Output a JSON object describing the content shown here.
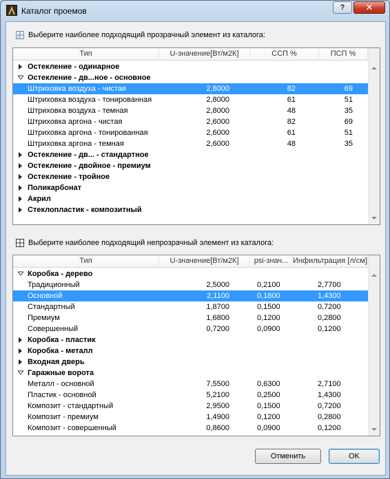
{
  "window": {
    "title": "Каталог проемов",
    "help_label": "?",
    "close_label": "✕"
  },
  "transparent": {
    "label": "Выберите наиболее подходящий прозрачный элемент из каталога:",
    "columns": [
      "Тип",
      "U-значение[Вт/м2К]",
      "ССП %",
      "ПСП %"
    ],
    "rows": [
      {
        "kind": "group",
        "expanded": false,
        "name": "Остекление - одинарное"
      },
      {
        "kind": "group",
        "expanded": true,
        "name": "Остекление - дв...ное - основное"
      },
      {
        "kind": "item",
        "selected": true,
        "name": "Штриховка воздуха - чистая",
        "v1": "2,8000",
        "v2": "82",
        "v3": "69"
      },
      {
        "kind": "item",
        "name": "Штриховка воздуха - тонированная",
        "v1": "2,8000",
        "v2": "61",
        "v3": "51"
      },
      {
        "kind": "item",
        "name": "Штриховка воздуха - темная",
        "v1": "2,8000",
        "v2": "48",
        "v3": "35"
      },
      {
        "kind": "item",
        "name": "Штриховка аргона - чистая",
        "v1": "2,6000",
        "v2": "82",
        "v3": "69"
      },
      {
        "kind": "item",
        "name": "Штриховка аргона - тонированная",
        "v1": "2,6000",
        "v2": "61",
        "v3": "51"
      },
      {
        "kind": "item",
        "name": "Штриховка аргона - темная",
        "v1": "2,6000",
        "v2": "48",
        "v3": "35"
      },
      {
        "kind": "group",
        "expanded": false,
        "name": "Остекление - дв... - стандартное"
      },
      {
        "kind": "group",
        "expanded": false,
        "name": "Остекление - двойное - премиум"
      },
      {
        "kind": "group",
        "expanded": false,
        "name": "Остекление - тройное"
      },
      {
        "kind": "group",
        "expanded": false,
        "name": "Поликарбонат"
      },
      {
        "kind": "group",
        "expanded": false,
        "name": "Акрил"
      },
      {
        "kind": "group",
        "expanded": false,
        "name": "Стеклопластик - композитный"
      }
    ]
  },
  "opaque": {
    "label": "Выберите наиболее подходящий непрозрачный элемент из каталога:",
    "columns": [
      "Тип",
      "U-значение[Вт/м2К]",
      "psi-знач...",
      "Инфильтрация [л/см]"
    ],
    "rows": [
      {
        "kind": "group",
        "expanded": true,
        "name": "Коробка - дерево"
      },
      {
        "kind": "item",
        "name": "Традиционный",
        "v1": "2,5000",
        "v2": "0,2100",
        "v3": "2,7700"
      },
      {
        "kind": "item",
        "selected": true,
        "name": "Основной",
        "v1": "2,1100",
        "v2": "0,1800",
        "v3": "1,4300"
      },
      {
        "kind": "item",
        "name": "Стандартный",
        "v1": "1,8700",
        "v2": "0,1500",
        "v3": "0,7200"
      },
      {
        "kind": "item",
        "name": "Премиум",
        "v1": "1,6800",
        "v2": "0,1200",
        "v3": "0,2800"
      },
      {
        "kind": "item",
        "name": "Совершенный",
        "v1": "0,7200",
        "v2": "0,0900",
        "v3": "0,1200"
      },
      {
        "kind": "group",
        "expanded": false,
        "name": "Коробка - пластик"
      },
      {
        "kind": "group",
        "expanded": false,
        "name": "Коробка - металл"
      },
      {
        "kind": "group",
        "expanded": false,
        "name": "Входная дверь"
      },
      {
        "kind": "group",
        "expanded": true,
        "name": "Гаражные ворота"
      },
      {
        "kind": "item",
        "name": "Металл - основной",
        "v1": "7,5500",
        "v2": "0,6300",
        "v3": "2,7100"
      },
      {
        "kind": "item",
        "name": "Пластик - основной",
        "v1": "5,2100",
        "v2": "0,2500",
        "v3": "1,4300"
      },
      {
        "kind": "item",
        "name": "Композит - стандартный",
        "v1": "2,9500",
        "v2": "0,1500",
        "v3": "0,7200"
      },
      {
        "kind": "item",
        "name": "Композит - премиум",
        "v1": "1,4900",
        "v2": "0,1200",
        "v3": "0,2800"
      },
      {
        "kind": "item",
        "name": "Композит - совершенный",
        "v1": "0,8600",
        "v2": "0,0900",
        "v3": "0,1200"
      }
    ]
  },
  "buttons": {
    "cancel": "Отменить",
    "ok": "OK"
  },
  "colors": {
    "selection": "#3399ff",
    "close": "#c7422a"
  },
  "icons": {
    "app": "archicad-icon",
    "transparent": "glazing-icon",
    "opaque": "frame-grid-icon"
  }
}
